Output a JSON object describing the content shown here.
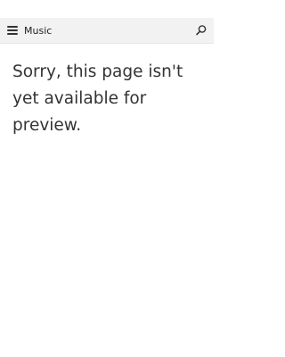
{
  "app_bar": {
    "title": "Music",
    "menu_icon": "hamburger-menu-icon",
    "search_icon": "search-icon"
  },
  "content": {
    "message": "Sorry, this page isn't yet available for preview."
  },
  "colors": {
    "app_bar_background": "#f2f2f2",
    "page_background": "#ffffff",
    "text": "#333333"
  }
}
